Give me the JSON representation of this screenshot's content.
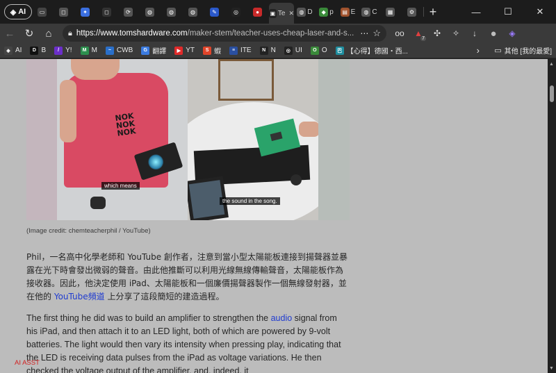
{
  "tabs": {
    "ai_label": "AI",
    "items": [
      {
        "label": "",
        "icon": "sidebar-icon",
        "color": "#444"
      },
      {
        "label": "",
        "icon": "app-icon",
        "color": "#555"
      },
      {
        "label": "",
        "icon": "gemini-icon",
        "color": "#3b6fe0"
      },
      {
        "label": "",
        "icon": "app-icon",
        "color": "#333"
      },
      {
        "label": "",
        "icon": "sync-icon",
        "color": "#555"
      },
      {
        "label": "",
        "icon": "globe-icon",
        "color": "#555"
      },
      {
        "label": "",
        "icon": "globe-icon",
        "color": "#555"
      },
      {
        "label": "",
        "icon": "globe-icon",
        "color": "#555"
      },
      {
        "label": "",
        "icon": "pen-icon",
        "color": "#2a58c9"
      },
      {
        "label": "",
        "icon": "openai-icon",
        "color": "#222"
      },
      {
        "label": "",
        "icon": "news-icon",
        "color": "#c92a2a"
      }
    ],
    "active": {
      "label": "Te",
      "close": "✕"
    },
    "after": [
      {
        "label": "D",
        "icon": "globe-icon",
        "color": "#555"
      },
      {
        "label": "p",
        "icon": "shield-icon",
        "color": "#3a8a3a"
      },
      {
        "label": "E",
        "icon": "doc-icon",
        "color": "#a0522d"
      },
      {
        "label": "C",
        "icon": "globe-icon",
        "color": "#555"
      },
      {
        "label": "",
        "icon": "grid-icon",
        "color": "#555"
      },
      {
        "label": "",
        "icon": "gear-icon",
        "color": "#555"
      }
    ],
    "new_tab": "+"
  },
  "window": {
    "minimize": "—",
    "maximize": "☐",
    "close": "✕"
  },
  "address": {
    "host": "https://www.tomshardware.com",
    "path": "/maker-stem/teacher-uses-cheap-laser-and-s..."
  },
  "extensions": [
    {
      "icon": "glasses-icon",
      "badge": ""
    },
    {
      "icon": "up-icon",
      "badge": "7"
    },
    {
      "icon": "pinwheel-icon",
      "badge": ""
    },
    {
      "icon": "puzzle-icon",
      "badge": ""
    },
    {
      "icon": "download-icon",
      "badge": ""
    },
    {
      "icon": "avatar-icon",
      "badge": ""
    },
    {
      "icon": "copilot-icon",
      "badge": ""
    }
  ],
  "bookmarks": [
    {
      "label": "AI",
      "icon": "ai-icon",
      "color": "#444"
    },
    {
      "label": "B",
      "icon": "d-icon",
      "color": "#111",
      "glyph": "D"
    },
    {
      "label": "Y!",
      "icon": "yahoo-icon",
      "color": "#6b2fc9",
      "glyph": "/"
    },
    {
      "label": "M",
      "icon": "m-icon",
      "color": "#2d8f4e",
      "glyph": "M"
    },
    {
      "label": "CWB",
      "icon": "cwb-icon",
      "color": "#2a6fc9",
      "glyph": "~"
    },
    {
      "label": "翻譯",
      "icon": "translate-icon",
      "color": "#3b7be0",
      "glyph": "G"
    },
    {
      "label": "YT",
      "icon": "youtube-icon",
      "color": "#e02a2a",
      "glyph": "▶"
    },
    {
      "label": "蝦",
      "icon": "shopee-icon",
      "color": "#e0442a",
      "glyph": "S"
    },
    {
      "label": "ITE",
      "icon": "ite-icon",
      "color": "#2a4fa0",
      "glyph": "≡"
    },
    {
      "label": "N",
      "icon": "n-icon",
      "color": "#222",
      "glyph": "N"
    },
    {
      "label": "UI",
      "icon": "openai-icon",
      "color": "#222",
      "glyph": "◎"
    },
    {
      "label": "O",
      "icon": "o-icon",
      "color": "#3a8a3a",
      "glyph": "O"
    },
    {
      "label": "【心得】德國・西...",
      "icon": "bahamut-icon",
      "color": "#1f8fa0",
      "glyph": "巴"
    }
  ],
  "bookmarks_more": "›",
  "bookmarks_other": "其他 [我的最愛]",
  "article": {
    "caption_left": "which means",
    "caption_right": "the sound in the song.",
    "shirt_text": "NOK\nNOK\nNOK",
    "credit": "(Image credit: chemteacherphil / YouTube)",
    "zh_paragraph_pre": "Phil，一名高中化學老師和 YouTube 創作者，注意到當小型太陽能板連接到揚聲器並暴露在光下時會發出微弱的聲音。由此他推斷可以利用光線無線傳輸聲音，太陽能板作為接收器。因此，他決定使用 iPad、太陽能板和一個廉價揚聲器製作一個無線發射器，並在他的 ",
    "zh_paragraph_link": "YouTube頻道",
    "zh_paragraph_post": " 上分享了這段簡短的建造過程。",
    "en_paragraph_pre": "The first thing he did was to build an amplifier to strengthen the ",
    "en_paragraph_link": "audio",
    "en_paragraph_post": " signal from his iPad, and then attach it to an LED light, both of which are powered by 9-volt batteries. The light would then vary its intensity when pressing play, indicating that the LED is receiving data pulses from the iPad as voltage variations. He then checked the voltage output of the amplifier, and, indeed, it"
  },
  "ai_assistant": "AI ASST",
  "colors": {
    "link": "#1f3bd0",
    "ai_assistant": "#d21f1f"
  }
}
